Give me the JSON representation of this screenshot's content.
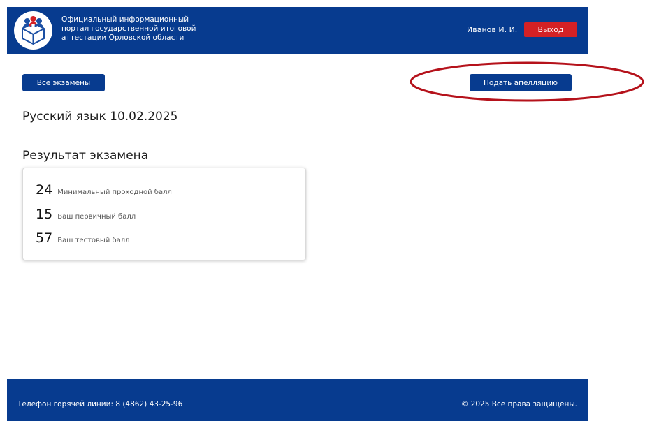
{
  "header": {
    "brand_lines": [
      "Официальный информационный",
      "портал государственной итоговой",
      "аттестации Орловской области"
    ],
    "user_name": "Иванов И. И.",
    "logout_label": "Выход",
    "logo_icon": "gia-logo-icon"
  },
  "actions": {
    "all_exams_label": "Все экзамены",
    "appeal_label": "Подать апелляцию"
  },
  "exam": {
    "title": "Русский язык 10.02.2025"
  },
  "result": {
    "title": "Результат экзамена",
    "rows": [
      {
        "value": "24",
        "label": "Минимальный проходной балл"
      },
      {
        "value": "15",
        "label": "Ваш первичный балл"
      },
      {
        "value": "57",
        "label": "Ваш тестовый балл"
      }
    ]
  },
  "footer": {
    "hotline": "Телефон горячей линии: 8 (4862) 43-25-96",
    "copyright": "© 2025 Все права защищены."
  },
  "colors": {
    "brand_blue": "#073b8f",
    "logout_red": "#d42125",
    "annotation_red": "#b5121b"
  }
}
